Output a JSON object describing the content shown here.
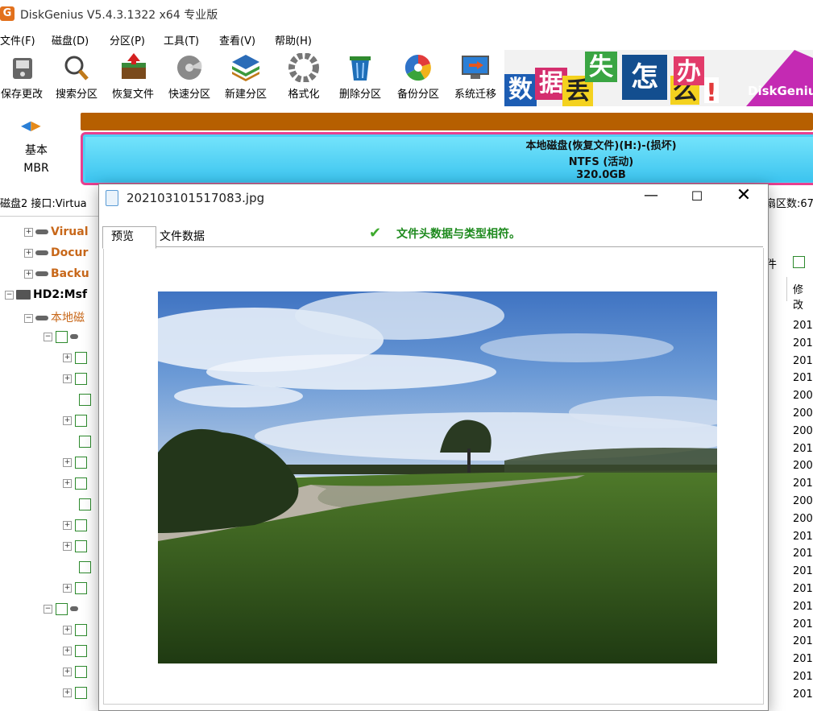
{
  "app": {
    "logo_glyph": "G",
    "title": "DiskGenius V5.4.3.1322 x64 专业版"
  },
  "menu": [
    "文件(F)",
    "磁盘(D)",
    "分区(P)",
    "工具(T)",
    "查看(V)",
    "帮助(H)"
  ],
  "toolbar": [
    {
      "label": "保存更改",
      "icon": "save-icon"
    },
    {
      "label": "搜索分区",
      "icon": "search-icon"
    },
    {
      "label": "恢复文件",
      "icon": "recover-icon"
    },
    {
      "label": "快速分区",
      "icon": "quick-partition-icon"
    },
    {
      "label": "新建分区",
      "icon": "new-partition-icon"
    },
    {
      "label": "格式化",
      "icon": "format-icon"
    },
    {
      "label": "删除分区",
      "icon": "delete-icon"
    },
    {
      "label": "备份分区",
      "icon": "backup-icon"
    },
    {
      "label": "系统迁移",
      "icon": "migrate-icon"
    }
  ],
  "banner": {
    "chars": [
      "数",
      "据",
      "丢",
      "失",
      "怎",
      "么",
      "办",
      "!"
    ],
    "brand": "DiskGenius"
  },
  "disk": {
    "type": "基本",
    "scheme": "MBR",
    "partition_line1": "本地磁盘(恢复文件)(H:)-(损坏)",
    "partition_line2": "NTFS (活动)",
    "partition_line3": "320.0GB",
    "info_left": "磁盘2 接口:Virtua",
    "info_right": "扇区数:67"
  },
  "tree": {
    "items": [
      "Virual",
      "Docur",
      "Backu",
      "HD2:Msf",
      "本地磁"
    ]
  },
  "right_list": {
    "header_fragment": "件",
    "col_header": "修改",
    "rows": [
      "201",
      "201",
      "201",
      "201",
      "200",
      "200",
      "200",
      "201",
      "200",
      "201",
      "200",
      "200",
      "201",
      "201",
      "201",
      "201",
      "201",
      "201",
      "201",
      "201",
      "201",
      "201"
    ]
  },
  "dialog": {
    "title": "202103101517083.jpg",
    "tabs": [
      "预览",
      "文件数据"
    ],
    "status": "文件头数据与类型相符。",
    "minimize": "—",
    "maximize": "☐",
    "close": "✕"
  },
  "colors": {
    "accent": "#e8408f",
    "partition": "#4fd0f5",
    "ok_green": "#1e8a1e"
  }
}
